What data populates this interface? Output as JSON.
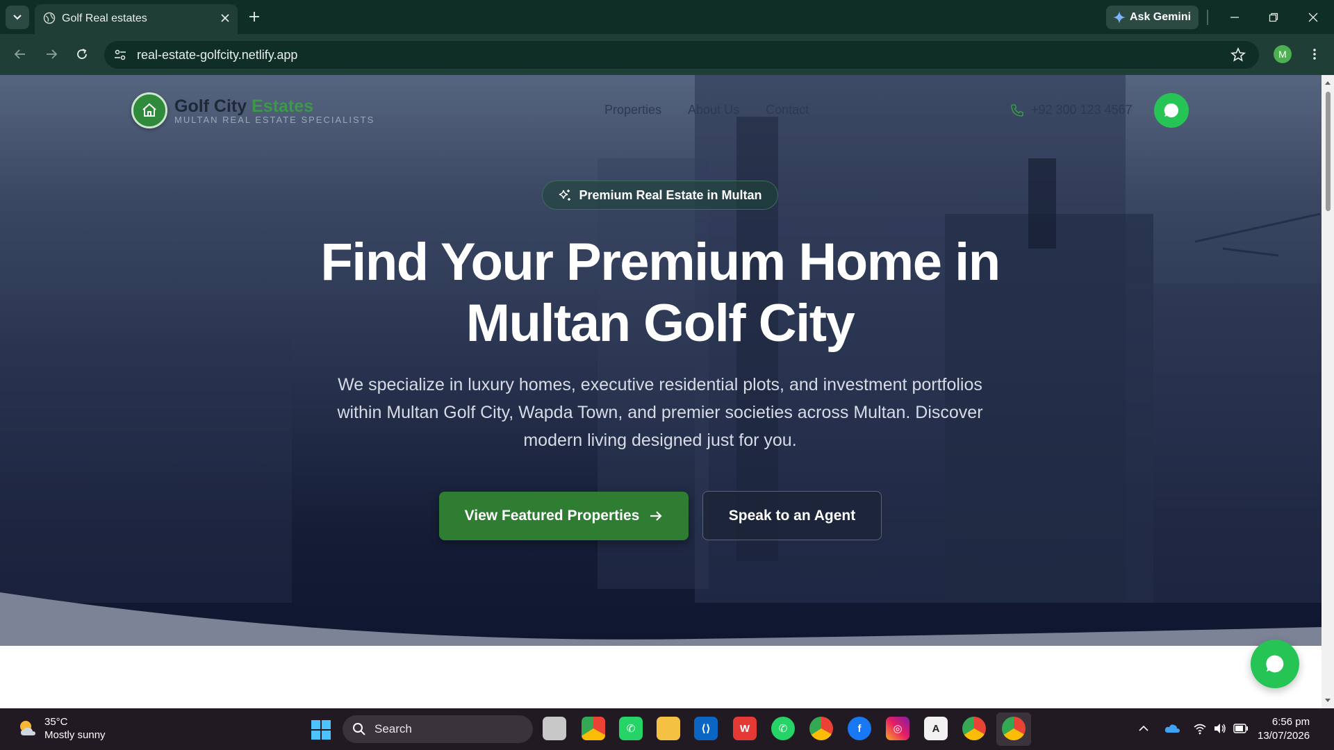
{
  "browser": {
    "tab_title": "Golf Real estates",
    "gemini_label": "Ask Gemini",
    "url": "real-estate-golfcity.netlify.app",
    "profile_initial": "M"
  },
  "page": {
    "brand": {
      "name_part1": "Golf City ",
      "name_part2": "Estates",
      "tagline": "MULTAN REAL ESTATE SPECIALISTS"
    },
    "nav": [
      "Properties",
      "About Us",
      "Contact"
    ],
    "phone": "+92 300 123 4567",
    "badge": "Premium Real Estate in Multan",
    "headline": "Find Your Premium Home in Multan Golf City",
    "subtext": "We specialize in luxury homes, executive residential plots, and investment portfolios within Multan Golf City, Wapda Town, and premier societies across Multan. Discover modern living designed just for you.",
    "cta_primary": "View Featured Properties",
    "cta_secondary": "Speak to an Agent"
  },
  "taskbar": {
    "temperature": "35°C",
    "condition": "Mostly sunny",
    "search_placeholder": "Search",
    "time": "6:56 pm",
    "date": "13/07/2026"
  },
  "colors": {
    "brand_green": "#2e7d32",
    "whatsapp_green": "#25c454",
    "chrome_dark": "#0f2e25"
  },
  "icons": [
    "chevron-down-icon",
    "globe-icon",
    "close-icon",
    "plus-icon",
    "gemini-sparkle-icon",
    "minimize-icon",
    "restore-icon",
    "back-icon",
    "forward-icon",
    "reload-icon",
    "site-info-icon",
    "star-icon",
    "kebab-menu-icon",
    "home-icon",
    "phone-icon",
    "chat-icon",
    "sparkles-icon",
    "arrow-right-icon",
    "windows-start-icon",
    "search-icon"
  ]
}
